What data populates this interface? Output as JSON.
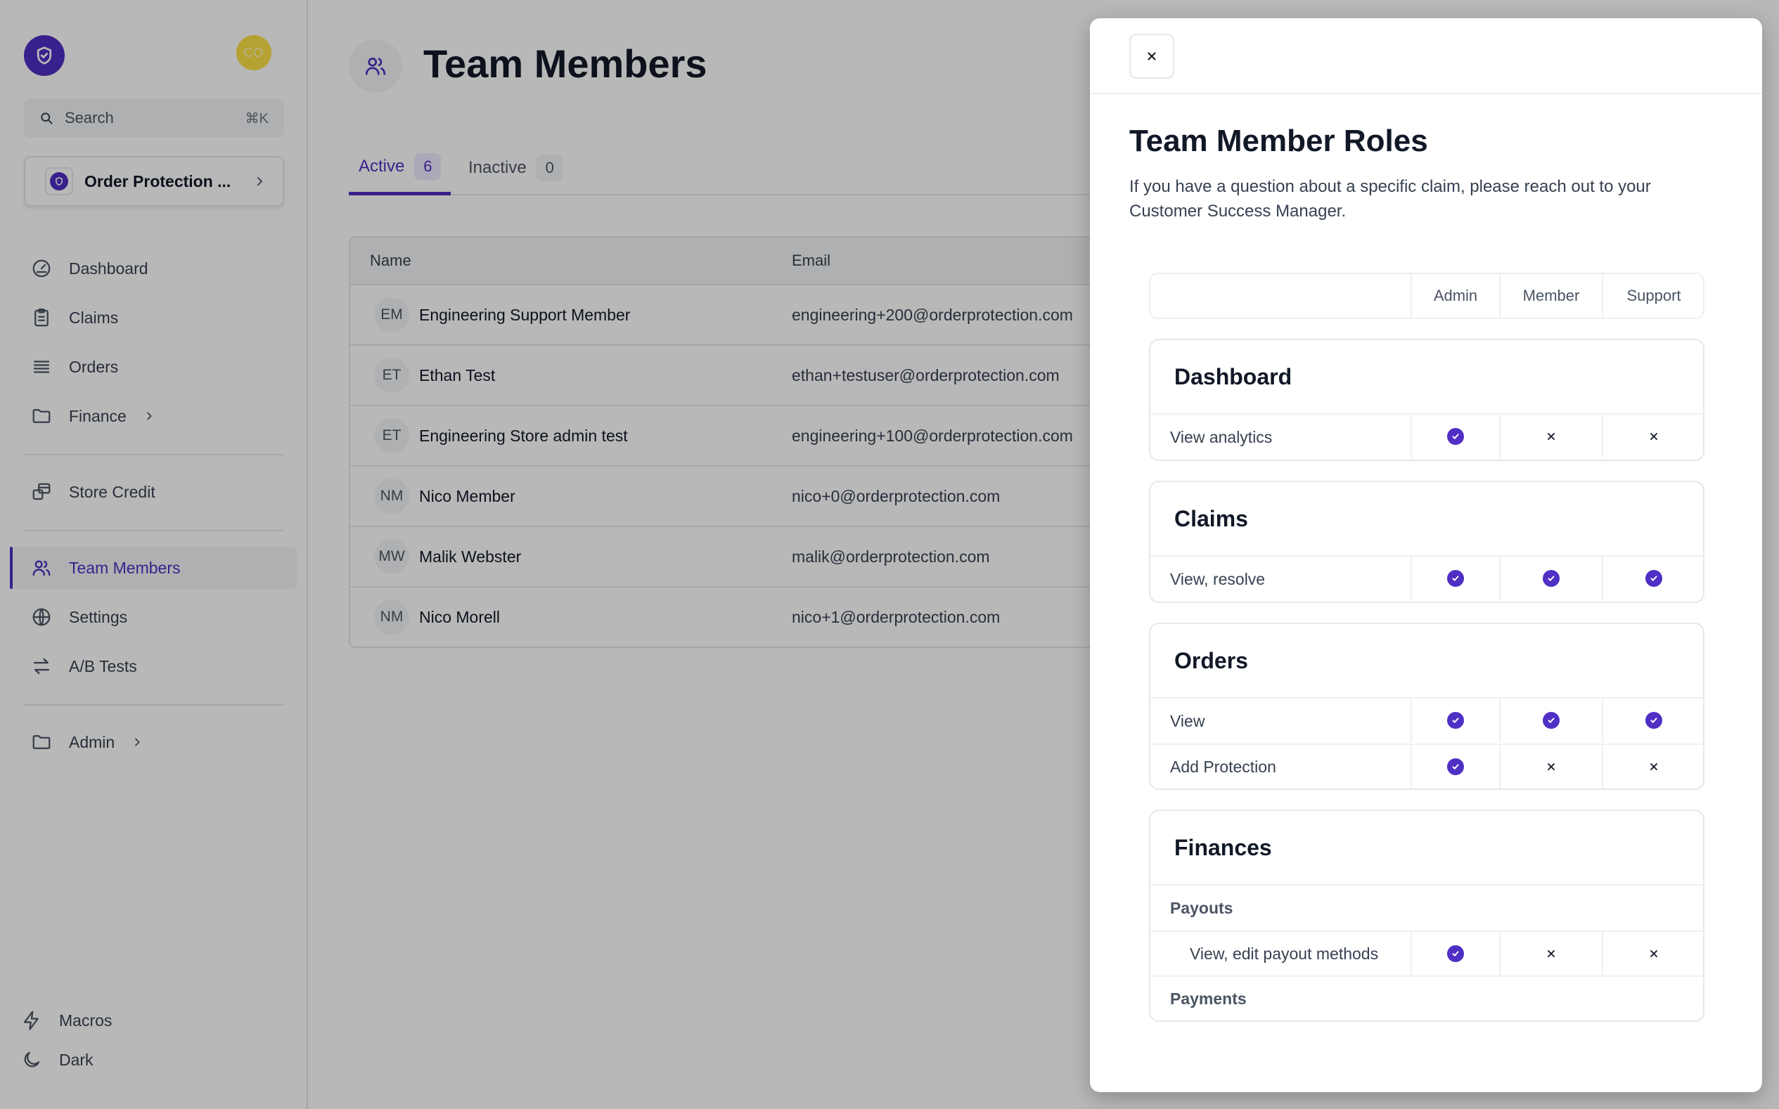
{
  "sidebar": {
    "user_initials": "CO",
    "search": {
      "label": "Search",
      "shortcut": "⌘K"
    },
    "store_name": "Order Protection ...",
    "nav": [
      {
        "label": "Dashboard"
      },
      {
        "label": "Claims"
      },
      {
        "label": "Orders"
      },
      {
        "label": "Finance"
      },
      {
        "label": "Store Credit"
      },
      {
        "label": "Team Members"
      },
      {
        "label": "Settings"
      },
      {
        "label": "A/B Tests"
      },
      {
        "label": "Admin"
      }
    ],
    "bottom": [
      {
        "label": "Macros"
      },
      {
        "label": "Dark"
      }
    ]
  },
  "main": {
    "title": "Team Members",
    "tabs": [
      {
        "label": "Active",
        "count": "6"
      },
      {
        "label": "Inactive",
        "count": "0"
      }
    ],
    "table": {
      "columns": [
        "Name",
        "Email"
      ],
      "rows": [
        {
          "initials": "EM",
          "name": "Engineering Support Member",
          "email": "engineering+200@orderprotection.com"
        },
        {
          "initials": "ET",
          "name": "Ethan Test",
          "email": "ethan+testuser@orderprotection.com"
        },
        {
          "initials": "ET",
          "name": "Engineering Store admin test",
          "email": "engineering+100@orderprotection.com"
        },
        {
          "initials": "NM",
          "name": "Nico Member",
          "email": "nico+0@orderprotection.com"
        },
        {
          "initials": "MW",
          "name": "Malik Webster",
          "email": "malik@orderprotection.com"
        },
        {
          "initials": "NM",
          "name": "Nico Morell",
          "email": "nico+1@orderprotection.com"
        }
      ]
    }
  },
  "drawer": {
    "title": "Team Member Roles",
    "description": "If you have a question about a specific claim, please reach out to your Customer Success Manager.",
    "roles": [
      "Admin",
      "Member",
      "Support"
    ],
    "sections": [
      {
        "title": "Dashboard",
        "rows": [
          {
            "label": "View analytics",
            "perms": [
              true,
              false,
              false
            ]
          }
        ]
      },
      {
        "title": "Claims",
        "rows": [
          {
            "label": "View, resolve",
            "perms": [
              true,
              true,
              true
            ]
          }
        ]
      },
      {
        "title": "Orders",
        "rows": [
          {
            "label": "View",
            "perms": [
              true,
              true,
              true
            ]
          },
          {
            "label": "Add Protection",
            "perms": [
              true,
              false,
              false
            ]
          }
        ]
      },
      {
        "title": "Finances",
        "groups": [
          {
            "label": "Payouts",
            "rows": [
              {
                "label": "View, edit payout methods",
                "perms": [
                  true,
                  false,
                  false
                ]
              }
            ]
          },
          {
            "label": "Payments"
          }
        ]
      }
    ]
  },
  "colors": {
    "accent": "#4f2fc4",
    "avatar": "#fde047"
  }
}
